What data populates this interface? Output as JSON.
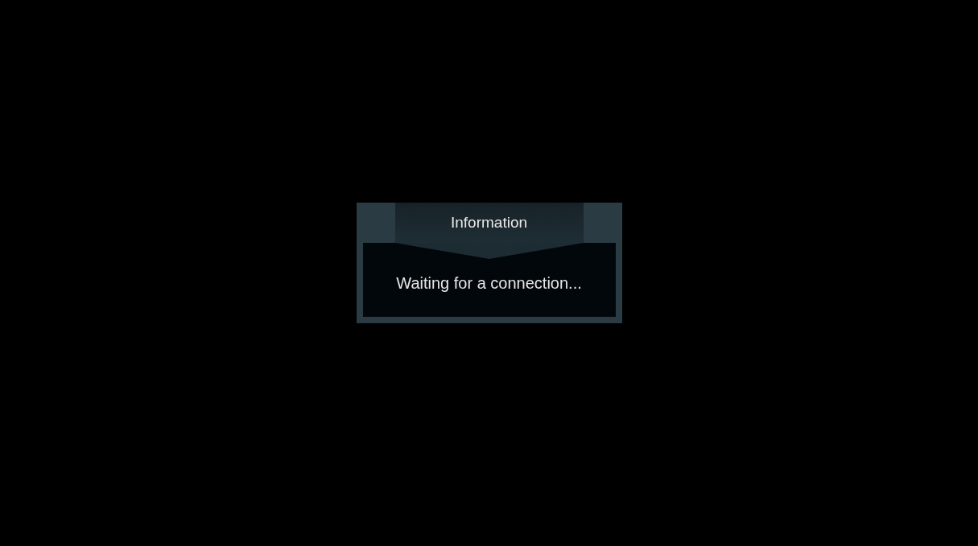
{
  "dialog": {
    "title": "Information",
    "message": "Waiting for a connection..."
  }
}
